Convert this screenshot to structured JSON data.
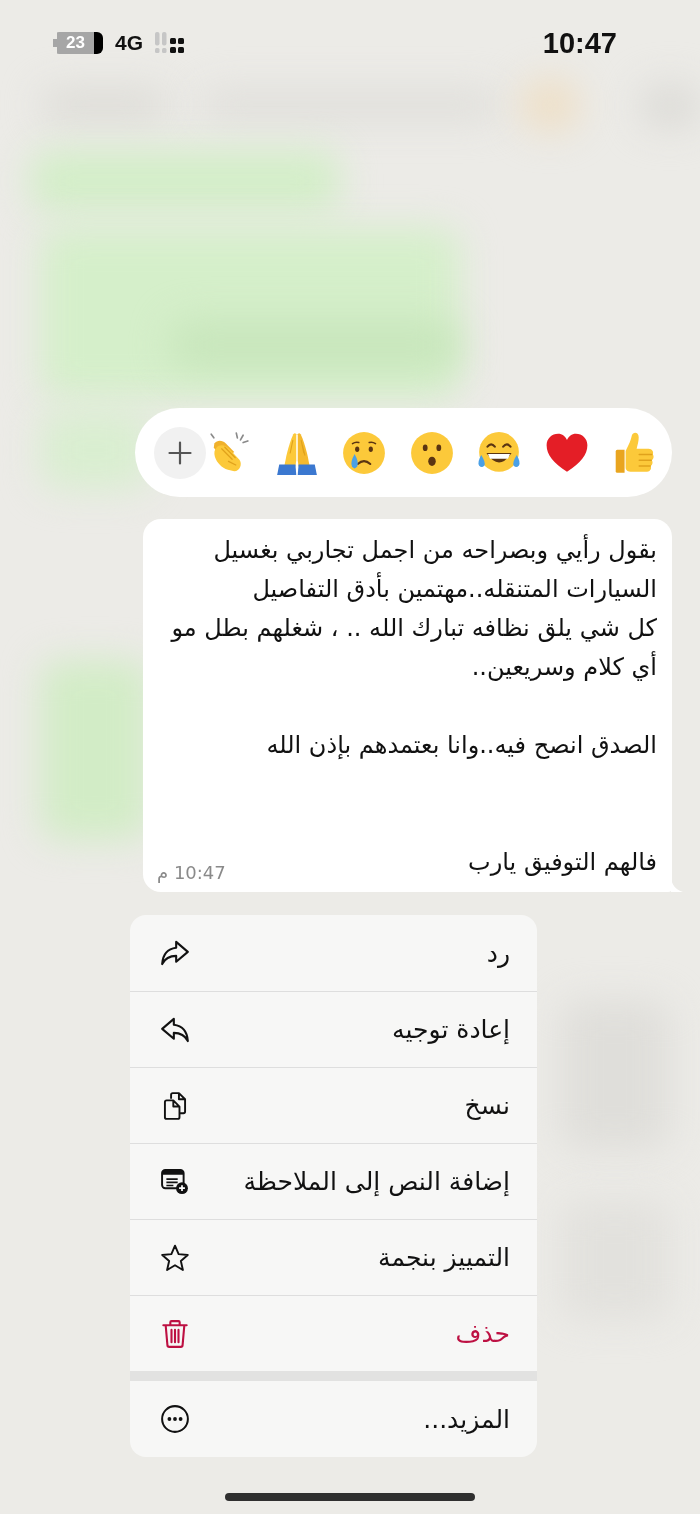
{
  "status_bar": {
    "battery": "23",
    "network": "4G",
    "time": "10:47"
  },
  "message": {
    "text": "بقول رأيي وبصراحه من اجمل تجاربي بغسيل\nالسيارات المتنقله..مهتمين بأدق التفاصيل\nكل شي يلق نظافه تبارك الله .. ، شغلهم بطل مو\nأي كلام وسريعين..\n\nالصدق انصح فيه..وانا بعتمدهم بإذن الله\n\n\nفالهم التوفيق يارب",
    "time": "10:47 م"
  },
  "menu": {
    "groups": [
      {
        "items": [
          {
            "label": "رد",
            "kind": "reply",
            "destructive": false
          },
          {
            "label": "إعادة توجيه",
            "kind": "forward",
            "destructive": false
          },
          {
            "label": "نسخ",
            "kind": "copy",
            "destructive": false
          },
          {
            "label": "إضافة النص إلى الملاحظة",
            "kind": "note",
            "destructive": false
          },
          {
            "label": "التمييز بنجمة",
            "kind": "star",
            "destructive": false
          },
          {
            "label": "حذف",
            "kind": "delete",
            "destructive": true
          }
        ]
      },
      {
        "items": [
          {
            "label": "المزيد...",
            "kind": "more",
            "destructive": false
          }
        ]
      }
    ]
  }
}
